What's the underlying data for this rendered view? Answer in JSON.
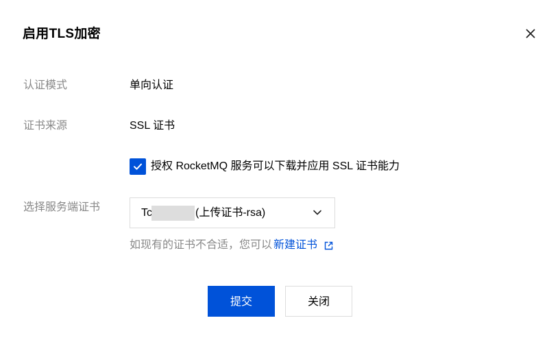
{
  "dialog": {
    "title": "启用TLS加密",
    "close_icon": "close-icon"
  },
  "form": {
    "auth_mode": {
      "label": "认证模式",
      "value": "单向认证"
    },
    "cert_source": {
      "label": "证书来源",
      "value": "SSL 证书"
    },
    "authorize": {
      "checked": true,
      "label": "授权 RocketMQ 服务可以下载并应用 SSL 证书能力"
    },
    "server_cert": {
      "label": "选择服务端证书",
      "selected_prefix": "Tc",
      "selected_suffix": "(上传证书-rsa)"
    },
    "hint": {
      "text": "如现有的证书不合适，您可以",
      "link": "新建证书"
    }
  },
  "footer": {
    "submit_label": "提交",
    "close_label": "关闭"
  },
  "colors": {
    "primary": "#0052d9",
    "label_gray": "#888888",
    "border": "#dcdcdc"
  }
}
